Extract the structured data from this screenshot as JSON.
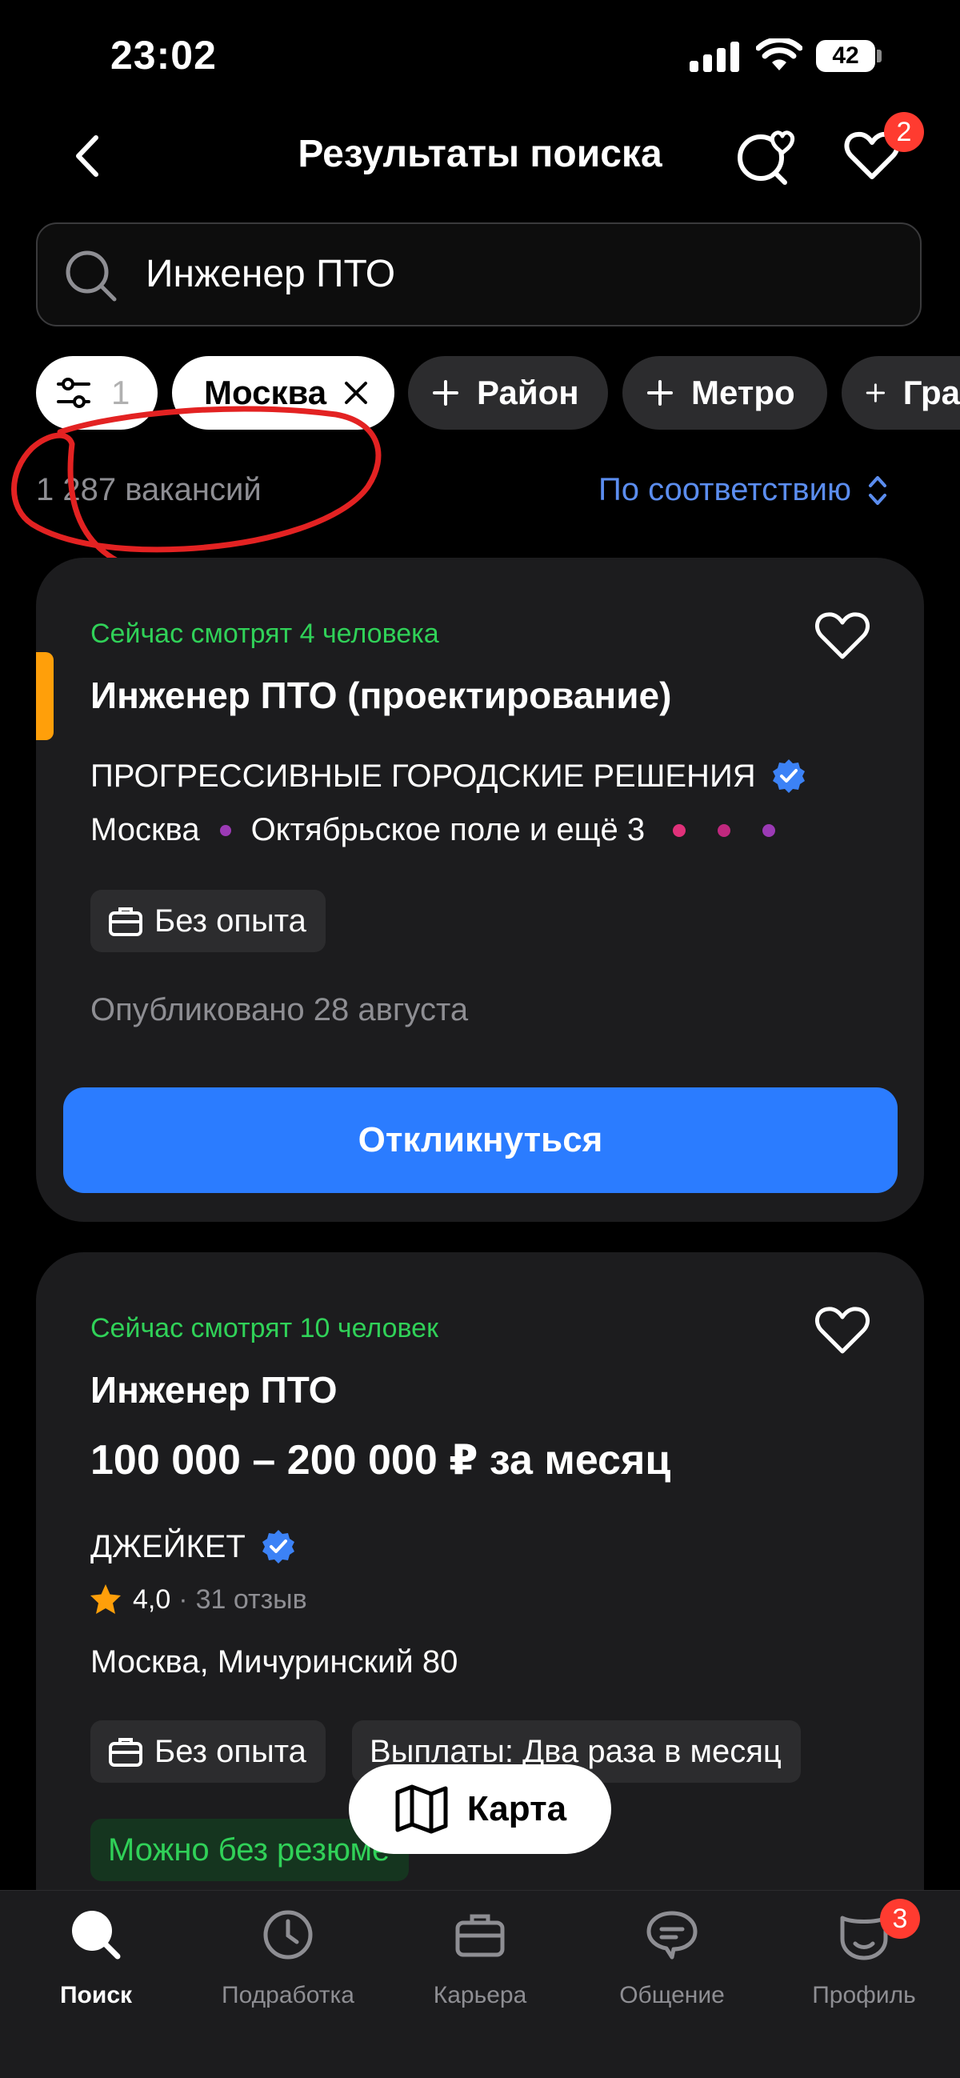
{
  "status_bar": {
    "time": "23:02",
    "battery": "42"
  },
  "header": {
    "title": "Результаты поиска",
    "favorites_badge": "2"
  },
  "search": {
    "value": "Инженер ПТО"
  },
  "filters": {
    "filter_count": "1",
    "chips": [
      "Москва",
      "Район",
      "Метро",
      "Гра"
    ]
  },
  "results": {
    "count": "1 287 вакансий",
    "sort": "По соответствию"
  },
  "vacancies": [
    {
      "viewers": "Сейчас смотрят 4 человека",
      "title": "Инженер ПТО (проектирование)",
      "company": "ПРОГРЕССИВНЫЕ ГОРОДСКИЕ РЕШЕНИЯ",
      "city": "Москва",
      "metro": "Октябрьское поле и ещё 3",
      "experience": "Без опыта",
      "published": "Опубликовано 28 августа",
      "apply": "Откликнуться"
    },
    {
      "viewers": "Сейчас смотрят 10 человек",
      "title": "Инженер ПТО",
      "salary": "100 000 – 200 000 ₽ за месяц",
      "company": "ДЖЕЙКЕТ",
      "rating": "4,0",
      "reviews": "31 отзыв",
      "address": "Москва, Мичуринский 80",
      "experience": "Без опыта",
      "payments": "Выплаты: Два раза в месяц",
      "no_resume": "Можно без резюме"
    }
  ],
  "map_button": "Карта",
  "tabs": [
    {
      "label": "Поиск"
    },
    {
      "label": "Подработка"
    },
    {
      "label": "Карьера"
    },
    {
      "label": "Общение"
    },
    {
      "label": "Профиль",
      "badge": "3"
    }
  ],
  "colors": {
    "accent_blue": "#2b7cff",
    "link_blue": "#5b8def",
    "green": "#30d158",
    "badge_red": "#ff3b30",
    "annotation_red": "#e32222",
    "card_bg": "#1c1c1e"
  }
}
